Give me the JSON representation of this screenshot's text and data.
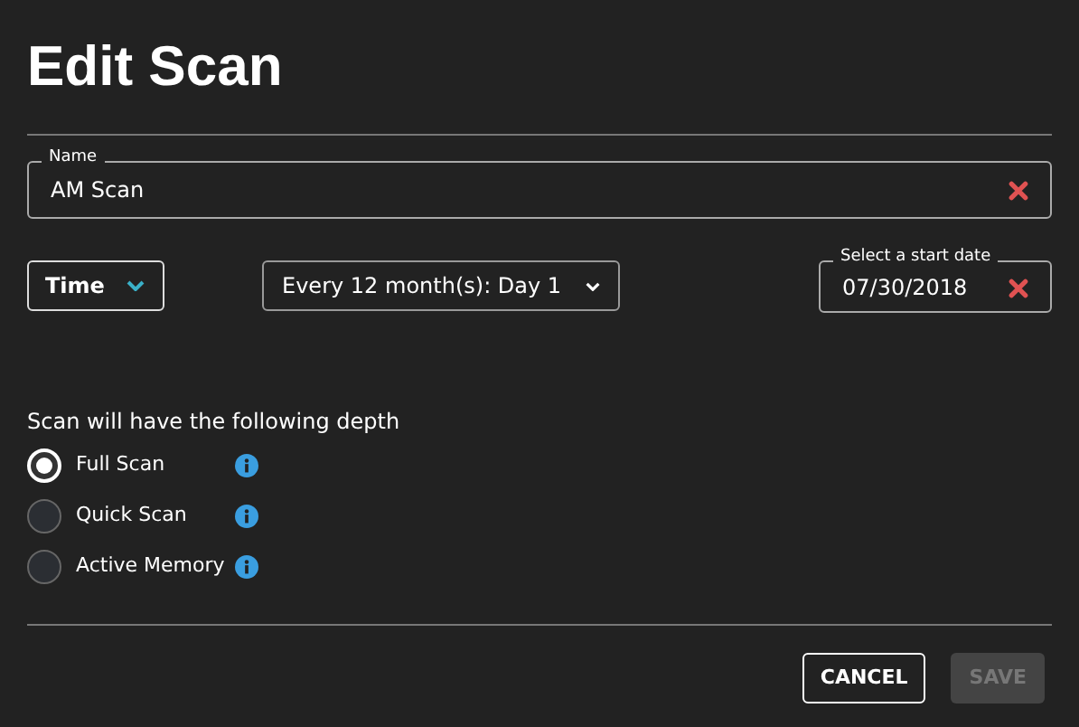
{
  "title": "Edit Scan",
  "name_field": {
    "label": "Name",
    "value": "AM Scan"
  },
  "schedule_type": {
    "label": "Time"
  },
  "frequency": {
    "value": "Every 12 month(s): Day 1"
  },
  "start_date": {
    "label": "Select a start date",
    "value": "07/30/2018"
  },
  "depth": {
    "prompt": "Scan will have the following depth",
    "options": [
      {
        "label": "Full Scan",
        "selected": true
      },
      {
        "label": "Quick Scan",
        "selected": false
      },
      {
        "label": "Active Memory",
        "selected": false
      }
    ]
  },
  "buttons": [
    {
      "label": "CANCEL",
      "disabled": false
    },
    {
      "label": "SAVE",
      "disabled": true
    }
  ]
}
